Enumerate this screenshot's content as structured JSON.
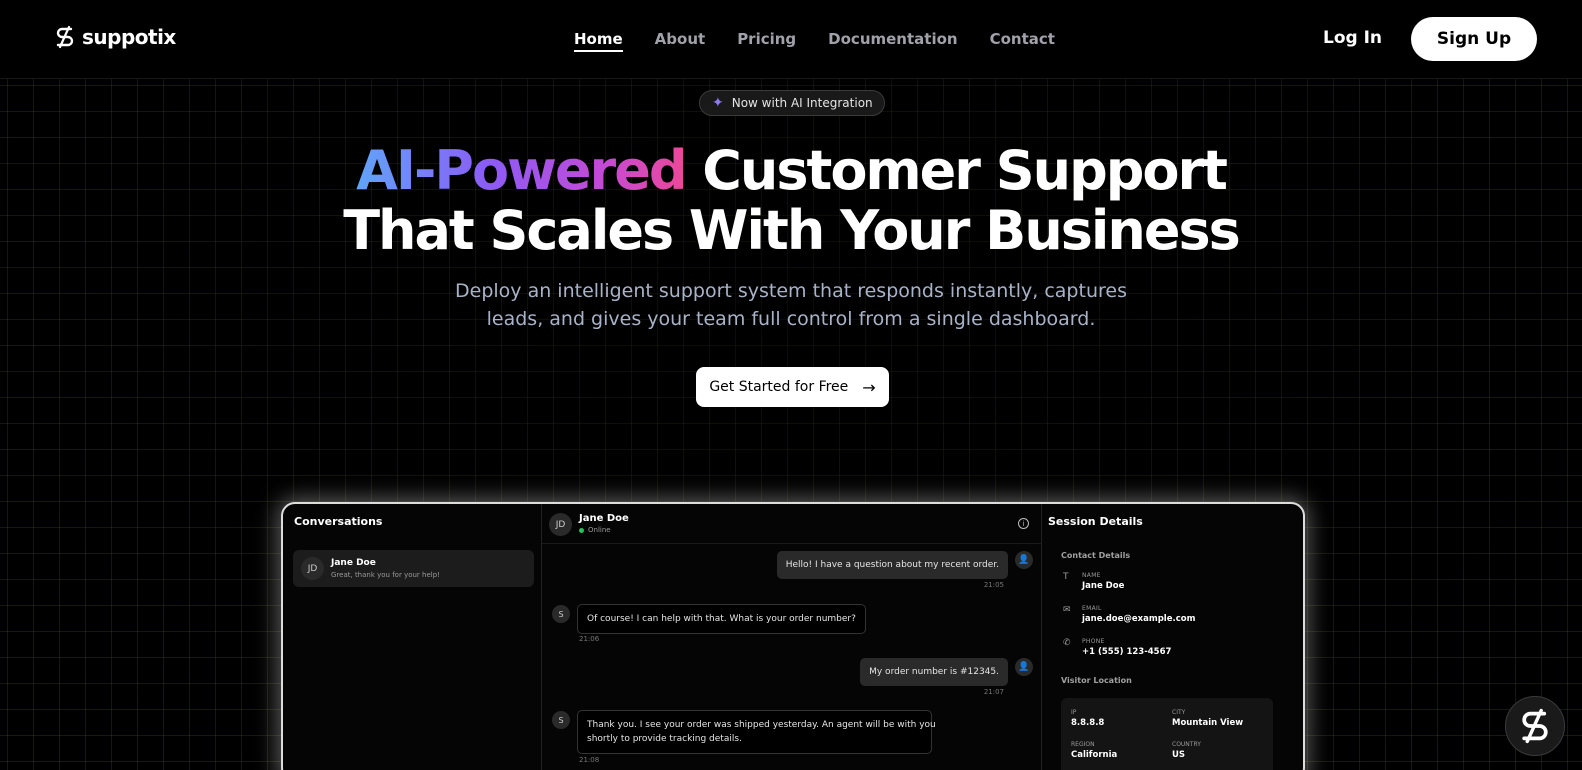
{
  "nav": {
    "logo_text": "suppotix",
    "links": [
      {
        "label": "Home",
        "active": true
      },
      {
        "label": "About"
      },
      {
        "label": "Pricing"
      },
      {
        "label": "Documentation"
      },
      {
        "label": "Contact"
      }
    ],
    "login_label": "Log In",
    "signup_label": "Sign Up"
  },
  "hero": {
    "badge_icon": "sparkle-icon",
    "badge_text": "Now with AI Integration",
    "headline_gradient": "AI-Powered",
    "headline_rest": " Customer Support",
    "headline_line2": "That Scales With Your Business",
    "subtitle_line1": "Deploy an intelligent support system that responds instantly, captures",
    "subtitle_line2": "leads, and gives your team full control from a single dashboard.",
    "cta_label": "Get Started for Free",
    "cta_icon": "arrow-right-icon"
  },
  "dashboard": {
    "conversations_title": "Conversations",
    "conversation": {
      "initials": "JD",
      "name": "Jane Doe",
      "preview": "Great, thank you for your help!"
    },
    "chat_header": {
      "initials": "JD",
      "name": "Jane Doe",
      "status": "Online"
    },
    "messages": [
      {
        "from": "user",
        "text": "Hello! I have a question about my recent order.",
        "time": "21:05"
      },
      {
        "from": "bot",
        "text": "Of course! I can help with that. What is your order number?",
        "time": "21:06"
      },
      {
        "from": "user",
        "text": "My order number is #12345.",
        "time": "21:07"
      },
      {
        "from": "bot",
        "text_line1": "Thank you. I see your order was shipped yesterday. An agent will be with you",
        "text_line2": "shortly to provide tracking details.",
        "time": "21:08"
      }
    ],
    "session": {
      "title": "Session Details",
      "contact_title": "Contact Details",
      "name_label": "NAME",
      "name": "Jane Doe",
      "email_label": "EMAIL",
      "email": "jane.doe@example.com",
      "phone_label": "PHONE",
      "phone": "+1 (555) 123-4567",
      "location_title": "Visitor Location",
      "ip_label": "IP",
      "ip": "8.8.8.8",
      "city_label": "CITY",
      "city": "Mountain View",
      "region_label": "REGION",
      "region": "California",
      "country_label": "COUNTRY",
      "country": "US"
    }
  },
  "colors": {
    "accent_gradient": [
      "#60a5fa",
      "#8b5cf6",
      "#ec4899"
    ],
    "online": "#22c55e"
  }
}
